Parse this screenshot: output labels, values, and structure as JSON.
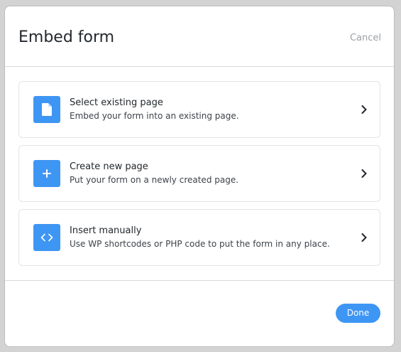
{
  "modal": {
    "title": "Embed form",
    "cancel_label": "Cancel",
    "done_label": "Done"
  },
  "options": [
    {
      "title": "Select existing page",
      "description": "Embed your form into an existing page.",
      "icon": "document-icon"
    },
    {
      "title": "Create new page",
      "description": "Put your form on a newly created page.",
      "icon": "plus-icon"
    },
    {
      "title": "Insert manually",
      "description": "Use WP shortcodes or PHP code to put the form in any place.",
      "icon": "code-icon"
    }
  ],
  "colors": {
    "accent": "#3e96f4",
    "title_text": "#23282d",
    "muted_text": "#9aa0a6"
  }
}
